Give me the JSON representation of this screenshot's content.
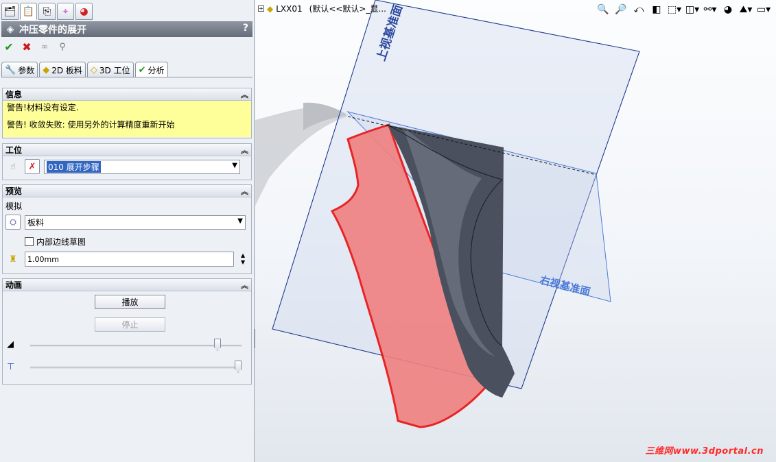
{
  "toolbar_tabs": [
    {
      "name": "feature-manager",
      "icon": "feature-tree-icon"
    },
    {
      "name": "property-manager",
      "icon": "property-icon"
    },
    {
      "name": "configuration-manager",
      "icon": "config-icon"
    },
    {
      "name": "dimxpert-manager",
      "icon": "target-icon"
    },
    {
      "name": "display-manager",
      "icon": "display-icon"
    }
  ],
  "panel": {
    "title": "冲压零件的展开",
    "help": "?",
    "actions": {
      "ok": "✔",
      "cancel": "✖"
    }
  },
  "property_tabs": [
    {
      "label": "参数",
      "icon": "wrench-icon"
    },
    {
      "label": "2D 板料",
      "icon": "sheet-icon"
    },
    {
      "label": "3D 工位",
      "icon": "station-icon"
    },
    {
      "label": "分析",
      "icon": "check-icon",
      "active": true
    }
  ],
  "info": {
    "title": "信息",
    "warnings": [
      "警告!材料没有设定.",
      "警告! 收敛失败: 使用另外的计算精度重新开始"
    ]
  },
  "position": {
    "title": "工位",
    "selected": "010 展开步骤"
  },
  "preview": {
    "title": "预览",
    "simulate_label": "模拟",
    "simulate_value": "板料",
    "checkbox_label": "内部边线草图",
    "checkbox_checked": false,
    "thickness_value": "1.00mm"
  },
  "animation": {
    "title": "动画",
    "play_label": "播放",
    "stop_label": "停止",
    "slider1": 0.9,
    "slider2": 1.0
  },
  "viewport": {
    "tree_label": "LXX01",
    "tree_config": "(默认<<默认>_显...",
    "plane_top_label": "上视基准面",
    "plane_right_label": "右视基准面",
    "watermark": "三维网www.3dportal.cn"
  },
  "colors": {
    "accent": "#3166c2",
    "warning_bg": "#ffff99",
    "blank_red": "#f08080",
    "plane_blue": "#1f3a8f"
  }
}
